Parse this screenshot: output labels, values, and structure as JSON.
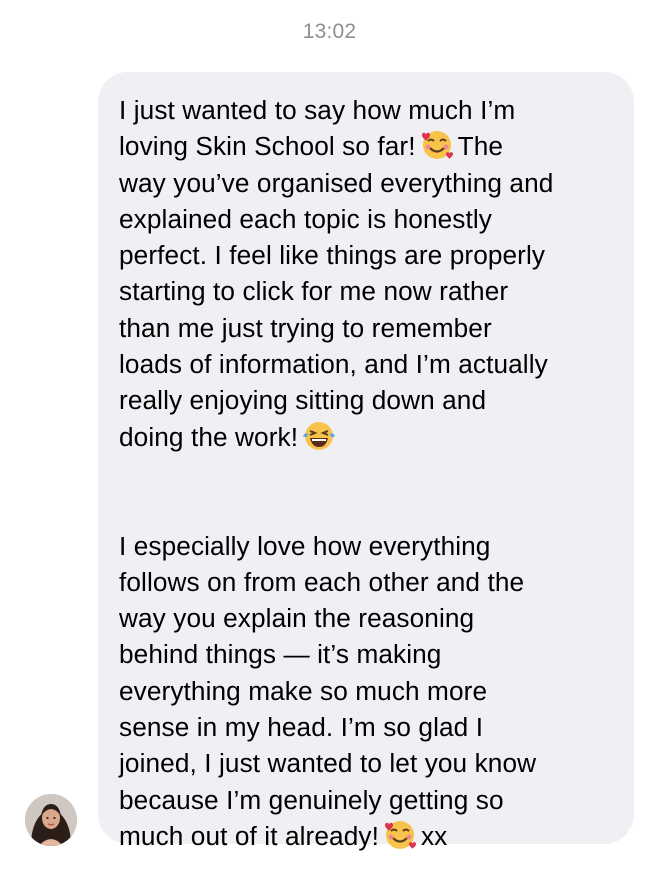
{
  "timestamp": "13:02",
  "message": {
    "lines_p1": [
      "I just wanted to say how much I’m",
      "loving Skin School so far!",
      "The",
      "way you’ve organised everything and",
      "explained each topic is honestly",
      "perfect. I feel like things are properly",
      "starting to click for me now rather",
      "than me just trying to remember",
      "loads of information, and I’m actually",
      "really enjoying sitting down and",
      "doing the work!"
    ],
    "lines_p2": [
      "I especially love how everything",
      "follows on from each other and the",
      "way you explain the reasoning",
      "behind things — it’s making",
      "everything make so much more",
      "sense in my head. I’m so glad I",
      "joined, I just wanted to let you know",
      "because I’m genuinely getting so",
      "much out of it already!",
      "xx"
    ]
  },
  "icons": {
    "emoji_1": "smiling-face-with-hearts-emoji",
    "emoji_2": "tears-of-joy-emoji",
    "emoji_3": "smiling-face-with-hearts-emoji",
    "avatar": "sender-avatar"
  },
  "colors": {
    "bubble": "#efeff4",
    "timestamp": "#8e8e93",
    "text": "#000000"
  }
}
